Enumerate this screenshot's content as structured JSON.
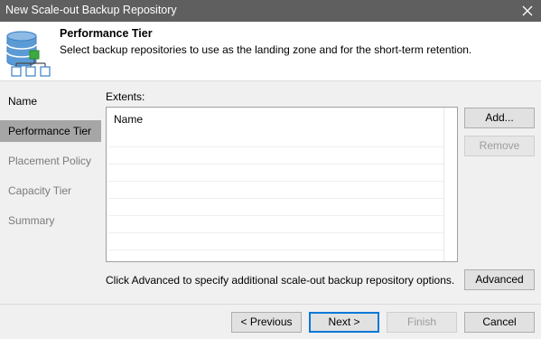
{
  "window": {
    "title": "New Scale-out Backup Repository"
  },
  "header": {
    "title": "Performance Tier",
    "subtitle": "Select backup repositories to use as the landing zone and for the short-term retention."
  },
  "sidebar": {
    "items": [
      {
        "label": "Name",
        "state": "done"
      },
      {
        "label": "Performance Tier",
        "state": "active"
      },
      {
        "label": "Placement Policy",
        "state": "pending"
      },
      {
        "label": "Capacity Tier",
        "state": "pending"
      },
      {
        "label": "Summary",
        "state": "pending"
      }
    ]
  },
  "extents": {
    "label": "Extents:",
    "column_header": "Name",
    "rows": []
  },
  "buttons": {
    "add": "Add...",
    "remove": "Remove",
    "advanced": "Advanced",
    "previous": "< Previous",
    "next": "Next >",
    "finish": "Finish",
    "cancel": "Cancel"
  },
  "advanced_hint": "Click Advanced to specify additional scale-out backup repository options.",
  "icons": {
    "close": "close-icon",
    "header": "backup-repository-icon"
  },
  "colors": {
    "titlebar": "#5f5f5f",
    "active_nav": "#a6a6a6",
    "default_button_border": "#0078d7",
    "icon_db": "#3b7fc4",
    "icon_green": "#3daa3d"
  }
}
